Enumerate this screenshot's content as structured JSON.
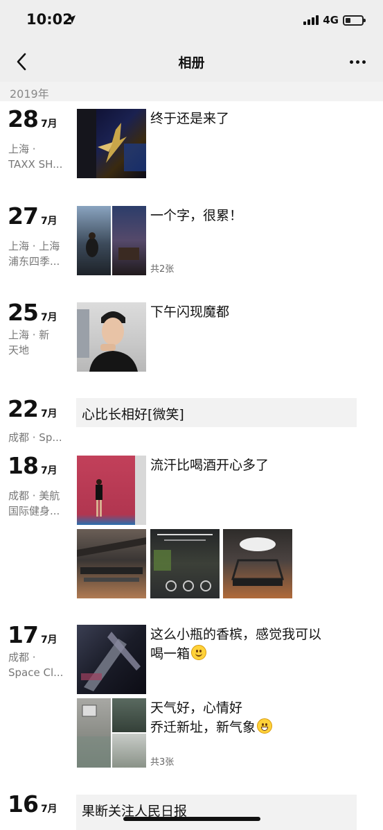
{
  "status_bar": {
    "time": "10:02",
    "network": "4G",
    "battery_level": 0.3
  },
  "navbar": {
    "title": "相册"
  },
  "album": {
    "year": "2019年",
    "month_suffix": "7月",
    "entries": [
      {
        "day": "28",
        "location": [
          "上海 ·",
          "TAXX SH..."
        ],
        "caption": "终于还是来了"
      },
      {
        "day": "27",
        "location": [
          "上海 · 上海",
          "浦东四季..."
        ],
        "caption": "一个字，很累！",
        "count": "共2张"
      },
      {
        "day": "25",
        "location": [
          "上海 · 新",
          "天地"
        ],
        "caption": "下午闪现魔都"
      },
      {
        "day": "22",
        "location": [
          "成都 · Sp..."
        ],
        "caption": "心比长相好[微笑]"
      },
      {
        "day": "18",
        "location": [
          "成都 · 美航",
          "国际健身..."
        ],
        "caption": "流汗比喝酒开心多了"
      },
      {
        "day": "17",
        "location": [
          "成都 ·",
          "Space Cl..."
        ],
        "caption_lines": [
          "这么小瓶的香槟，感觉我可以",
          "喝一箱"
        ],
        "caption2_lines": [
          "天气好，心情好",
          "乔迁新址，新气象"
        ],
        "count": "共3张"
      },
      {
        "day": "16",
        "caption": "果断关注人民日报"
      }
    ]
  },
  "icons": {
    "back": "chevron-left-icon",
    "more": "more-dots-icon",
    "smile": "smile-emoji-icon",
    "grin": "grin-emoji-icon"
  },
  "colors": {
    "bar_background": "#eeeeee",
    "card_background": "#f2f2f2",
    "location_text": "#777777"
  }
}
